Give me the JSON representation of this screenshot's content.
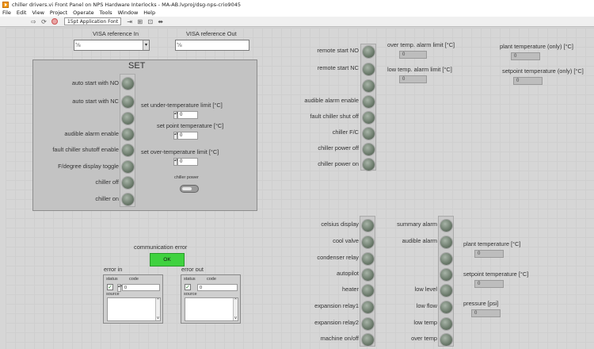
{
  "window": {
    "title": "chiller drivers.vi Front Panel on NPS Hardware Interlocks - MA-AB.lvproj/dsg-nps-crio9045"
  },
  "menu": [
    "File",
    "Edit",
    "View",
    "Project",
    "Operate",
    "Tools",
    "Window",
    "Help"
  ],
  "toolbar": {
    "font": "15pt Application Font"
  },
  "visa": {
    "in_label": "VISA reference In",
    "out_label": "VISA reference Out",
    "in_value": "",
    "out_value": ""
  },
  "set_panel": {
    "title": "SET",
    "leds": [
      "auto start with NO",
      "auto start with NC",
      "",
      "audible alarm enable",
      "fault chiller shutoff enable",
      "F/degree display toggle",
      "chiller off",
      "chiller on"
    ],
    "under_temp_label": "set under-temperature limit [°C]",
    "under_temp_value": "0",
    "setpoint_label": "set point temperature [°C]",
    "setpoint_value": "0",
    "over_temp_label": "set over-temperature limit [°C]",
    "over_temp_value": "0",
    "chiller_power_label": "chiller power"
  },
  "status_top": {
    "leds": [
      "remote start NO",
      "remote start NC",
      "",
      "audible alarm enable",
      "fault chiller shut off",
      "chiller F/C",
      "chiller power off",
      "chiller power on"
    ],
    "over_temp_label": "over temp. alarm limit [°C]",
    "over_temp_value": "0",
    "low_temp_label": "low temp. alarm limit [°C]",
    "low_temp_value": "0",
    "plant_temp_label": "plant temperature (only) [°C]",
    "plant_temp_value": "0",
    "setpoint_temp_label": "setpoint temperature (only) [°C]",
    "setpoint_temp_value": "0"
  },
  "status_bottom": {
    "left_leds": [
      "celsius display",
      "cool valve",
      "condenser relay",
      "autopilot",
      "heater",
      "expansion relay1",
      "expansion relay2",
      "machine on/off"
    ],
    "right_leds": [
      "summary alarm",
      "audible alarm",
      "",
      "",
      "low level",
      "low flow",
      "low temp",
      "over temp"
    ],
    "plant_temp_label": "plant temperature [°C]",
    "plant_temp_value": "0",
    "setpoint_label": "setpoint temperature [°C]",
    "setpoint_value": "0",
    "pressure_label": "pressure [psi]",
    "pressure_value": "0"
  },
  "comm": {
    "label": "communication error",
    "button": "OK"
  },
  "error_in": {
    "label": "error in",
    "status": "status",
    "code": "code",
    "code_value": "0",
    "source": "source"
  },
  "error_out": {
    "label": "error out",
    "status": "status",
    "code": "code",
    "code_value": "0",
    "source": "source"
  }
}
